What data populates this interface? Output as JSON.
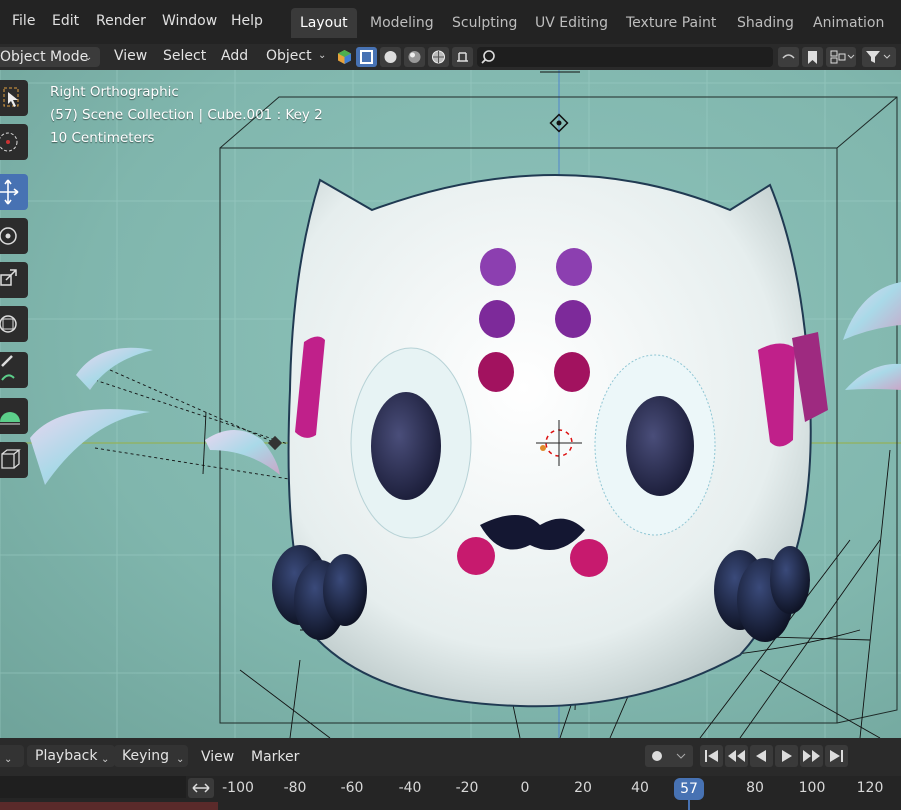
{
  "top_menu": {
    "items": [
      "File",
      "Edit",
      "Render",
      "Window",
      "Help"
    ]
  },
  "workspaces": {
    "tabs": [
      "Layout",
      "Modeling",
      "Sculpting",
      "UV Editing",
      "Texture Paint",
      "Shading",
      "Animation"
    ],
    "active": "Layout"
  },
  "viewport_header": {
    "mode": "Object Mode",
    "menus": [
      "View",
      "Select",
      "Add",
      "Object"
    ]
  },
  "viewport_overlay": {
    "view_name": "Right Orthographic",
    "scene_info": "(57) Scene Collection | Cube.001 : Key 2",
    "scale": "10 Centimeters"
  },
  "timeline": {
    "menus": [
      "Playback",
      "Keying",
      "View",
      "Marker"
    ],
    "ticks": [
      "-100",
      "-80",
      "-60",
      "-40",
      "-20",
      "0",
      "20",
      "40",
      "80",
      "100",
      "120"
    ],
    "current_frame": "57"
  },
  "colors": {
    "viewport_bg": "#86bdb4",
    "accent": "#4772b3",
    "dots_purple": "#8c3fb0",
    "dots_magenta": "#a2125f"
  }
}
